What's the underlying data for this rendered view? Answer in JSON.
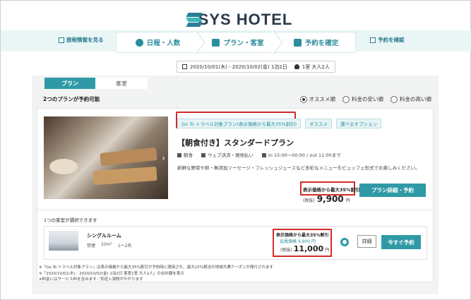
{
  "brand": {
    "name": "SYS HOTEL"
  },
  "stepbar": {
    "left_link": "旅程情報を見る",
    "right_link": "予約を確認",
    "steps": [
      {
        "label": "日程・人数"
      },
      {
        "label": "プラン・客室"
      },
      {
        "label": "予約を確定"
      }
    ]
  },
  "search": {
    "dates": "2020/10/01(木) - 2020/10/02(金) 1泊2日",
    "guests": "1室 大人2人"
  },
  "tabs": [
    {
      "label": "プラン",
      "active": true
    },
    {
      "label": "客室",
      "active": false
    }
  ],
  "results": {
    "count_text": "2つのプランが予約可能"
  },
  "sort": {
    "options": [
      "オススメ順",
      "料金の安い順",
      "料金の高い順"
    ],
    "selected": "オススメ順"
  },
  "plan": {
    "tags": [
      "Go To トラベル対象プラン(表示価格から最大35%割引)",
      "オススメ",
      "選べるオプション"
    ],
    "title": "【朝食付き】スタンダードプラン",
    "meals": "朝食",
    "payment": "ウェブ決済・現地払い",
    "checkin": "in 15:00～00:00 / out 11:00まで",
    "description": "新鮮な野菜や卵・無添加ソーセージ・フレッシュジュースなど多彩なメニューをビュッフェ形式でお楽しみください。",
    "discount_note": "表示価格から最大35%割引",
    "tax_label": "(税抜)",
    "price": "9,900",
    "yen": "円",
    "detail_button": "プラン詳細・予約"
  },
  "room_section": {
    "count_text": "1つの客室が選択できます"
  },
  "room": {
    "name": "シングルルーム",
    "smoking": "禁煙",
    "size": "20m²",
    "capacity": "1～2名",
    "discount_note": "表示価格から最大35%割引",
    "member_label": "会員価格",
    "member_price": "9,900",
    "tax_label": "(税抜)",
    "price": "11,000",
    "yen": "円",
    "detail_button": "詳細",
    "book_button": "今すぐ予約"
  },
  "notes": [
    "※「Go To トラベル対象プラン」は表示価格から最大35%割引が予約時に適用され、最大15%相当の地域共通クーポンが発行されます",
    "※「2020/10/01(木) - 2020/10/02(金) 1泊2日 客室1室 大人2人」の合計額を表示",
    "※料金にはサービス料を含みます／別途入湯税がかかります"
  ],
  "colors": {
    "accent": "#2f9aa6",
    "highlight": "#d42a2a"
  }
}
